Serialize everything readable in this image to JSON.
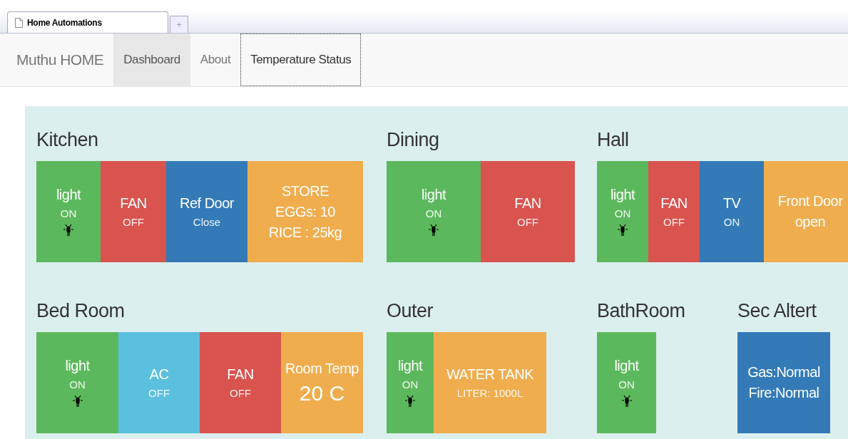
{
  "browser": {
    "tab_title": "Home Automations",
    "new_tab": "+"
  },
  "navbar": {
    "brand": "Muthu HOME",
    "items": [
      {
        "label": "Dashboard",
        "selected": true,
        "focused": false
      },
      {
        "label": "About",
        "selected": false,
        "focused": false
      },
      {
        "label": "Temperature Status",
        "selected": false,
        "focused": true
      }
    ]
  },
  "rows": [
    {
      "rooms": [
        {
          "name": "Kitchen",
          "tiles": [
            {
              "kind": "light",
              "color": "#5cb85c",
              "lines": [
                {
                  "kind": "title",
                  "text": "light"
                },
                {
                  "kind": "status",
                  "text": "ON"
                }
              ]
            },
            {
              "kind": "device",
              "color": "#d9534f",
              "lines": [
                {
                  "kind": "title",
                  "text": "FAN"
                },
                {
                  "kind": "status",
                  "text": "OFF"
                }
              ]
            },
            {
              "kind": "device",
              "color": "#337ab7",
              "lines": [
                {
                  "kind": "title",
                  "text": "Ref Door"
                },
                {
                  "kind": "status",
                  "text": "Close"
                }
              ]
            },
            {
              "kind": "device",
              "color": "#f0ad4e",
              "lines": [
                {
                  "kind": "title",
                  "text": "STORE"
                },
                {
                  "kind": "title",
                  "text": "EGGs: 10"
                },
                {
                  "kind": "title",
                  "text": "RICE : 25kg"
                }
              ]
            }
          ]
        },
        {
          "name": "Dining",
          "tiles": [
            {
              "kind": "light",
              "color": "#5cb85c",
              "lines": [
                {
                  "kind": "title",
                  "text": "light"
                },
                {
                  "kind": "status",
                  "text": "ON"
                }
              ]
            },
            {
              "kind": "device",
              "color": "#d9534f",
              "lines": [
                {
                  "kind": "title",
                  "text": "FAN"
                },
                {
                  "kind": "status",
                  "text": "OFF"
                }
              ]
            }
          ]
        },
        {
          "name": "Hall",
          "tiles": [
            {
              "kind": "light",
              "color": "#5cb85c",
              "lines": [
                {
                  "kind": "title",
                  "text": "light"
                },
                {
                  "kind": "status",
                  "text": "ON"
                }
              ]
            },
            {
              "kind": "device",
              "color": "#d9534f",
              "lines": [
                {
                  "kind": "title",
                  "text": "FAN"
                },
                {
                  "kind": "status",
                  "text": "OFF"
                }
              ]
            },
            {
              "kind": "device",
              "color": "#337ab7",
              "lines": [
                {
                  "kind": "title",
                  "text": "TV"
                },
                {
                  "kind": "status",
                  "text": "ON"
                }
              ]
            },
            {
              "kind": "device",
              "color": "#f0ad4e",
              "lines": [
                {
                  "kind": "title",
                  "text": "Front Door"
                },
                {
                  "kind": "title",
                  "text": "open"
                }
              ]
            }
          ]
        }
      ]
    },
    {
      "rooms": [
        {
          "name": "Bed Room",
          "tiles": [
            {
              "kind": "light",
              "color": "#5cb85c",
              "lines": [
                {
                  "kind": "title",
                  "text": "light"
                },
                {
                  "kind": "status",
                  "text": "ON"
                }
              ]
            },
            {
              "kind": "device",
              "color": "#5bc0de",
              "lines": [
                {
                  "kind": "title",
                  "text": "AC"
                },
                {
                  "kind": "status",
                  "text": "OFF"
                }
              ]
            },
            {
              "kind": "device",
              "color": "#d9534f",
              "lines": [
                {
                  "kind": "title",
                  "text": "FAN"
                },
                {
                  "kind": "status",
                  "text": "OFF"
                }
              ]
            },
            {
              "kind": "device",
              "color": "#f0ad4e",
              "lines": [
                {
                  "kind": "title",
                  "text": "Room Temp"
                },
                {
                  "kind": "big",
                  "text": "20 C"
                }
              ]
            }
          ]
        },
        {
          "name": "Outer",
          "tiles": [
            {
              "kind": "light",
              "color": "#5cb85c",
              "lines": [
                {
                  "kind": "title",
                  "text": "light"
                },
                {
                  "kind": "status",
                  "text": "ON"
                }
              ]
            },
            {
              "kind": "device",
              "color": "#f0ad4e",
              "lines": [
                {
                  "kind": "title",
                  "text": "WATER TANK"
                },
                {
                  "kind": "status",
                  "text": "LITER: 1000L"
                }
              ]
            }
          ]
        },
        {
          "name": "BathRoom",
          "tiles": [
            {
              "kind": "light",
              "color": "#5cb85c",
              "lines": [
                {
                  "kind": "title",
                  "text": "light"
                },
                {
                  "kind": "status",
                  "text": "ON"
                }
              ]
            }
          ]
        },
        {
          "name": "Sec Altert",
          "tiles": [
            {
              "kind": "device",
              "color": "#337ab7",
              "lines": [
                {
                  "kind": "title",
                  "text": "Gas:Normal"
                },
                {
                  "kind": "title",
                  "text": "Fire:Normal"
                }
              ]
            }
          ]
        }
      ]
    }
  ]
}
